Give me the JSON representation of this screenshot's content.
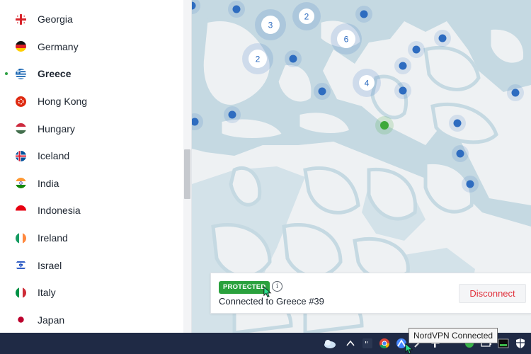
{
  "sidebar": {
    "countries": [
      {
        "name": "Georgia",
        "flag": "georgia-flag-icon",
        "selected": false
      },
      {
        "name": "Germany",
        "flag": "germany-flag-icon",
        "selected": false
      },
      {
        "name": "Greece",
        "flag": "greece-flag-icon",
        "selected": true
      },
      {
        "name": "Hong Kong",
        "flag": "hong-kong-flag-icon",
        "selected": false
      },
      {
        "name": "Hungary",
        "flag": "hungary-flag-icon",
        "selected": false
      },
      {
        "name": "Iceland",
        "flag": "iceland-flag-icon",
        "selected": false
      },
      {
        "name": "India",
        "flag": "india-flag-icon",
        "selected": false
      },
      {
        "name": "Indonesia",
        "flag": "indonesia-flag-icon",
        "selected": false
      },
      {
        "name": "Ireland",
        "flag": "ireland-flag-icon",
        "selected": false
      },
      {
        "name": "Israel",
        "flag": "israel-flag-icon",
        "selected": false
      },
      {
        "name": "Italy",
        "flag": "italy-flag-icon",
        "selected": false
      },
      {
        "name": "Japan",
        "flag": "japan-flag-icon",
        "selected": false
      }
    ]
  },
  "map": {
    "clusters": [
      {
        "count": "3"
      },
      {
        "count": "2"
      },
      {
        "count": "2"
      },
      {
        "count": "6"
      },
      {
        "count": "4"
      }
    ],
    "colors": {
      "sea": "#c5d9e2",
      "land": "#eef1f3",
      "server": "#2e6cc0",
      "connected": "#3ea93a"
    }
  },
  "status": {
    "badge": "PROTECTED",
    "connection": "Connected to Greece #39",
    "disconnect_label": "Disconnect",
    "accent": "#2aa13d"
  },
  "taskbar": {
    "tooltip": "NordVPN Connected",
    "tray_icons": [
      "weather-icon",
      "chevron-up-icon",
      "quote-app-icon",
      "chrome-icon",
      "nordvpn-icon",
      "pen-icon",
      "slack-icon",
      "green-app-icon",
      "battery-icon",
      "terminal-icon",
      "shield-icon"
    ]
  }
}
